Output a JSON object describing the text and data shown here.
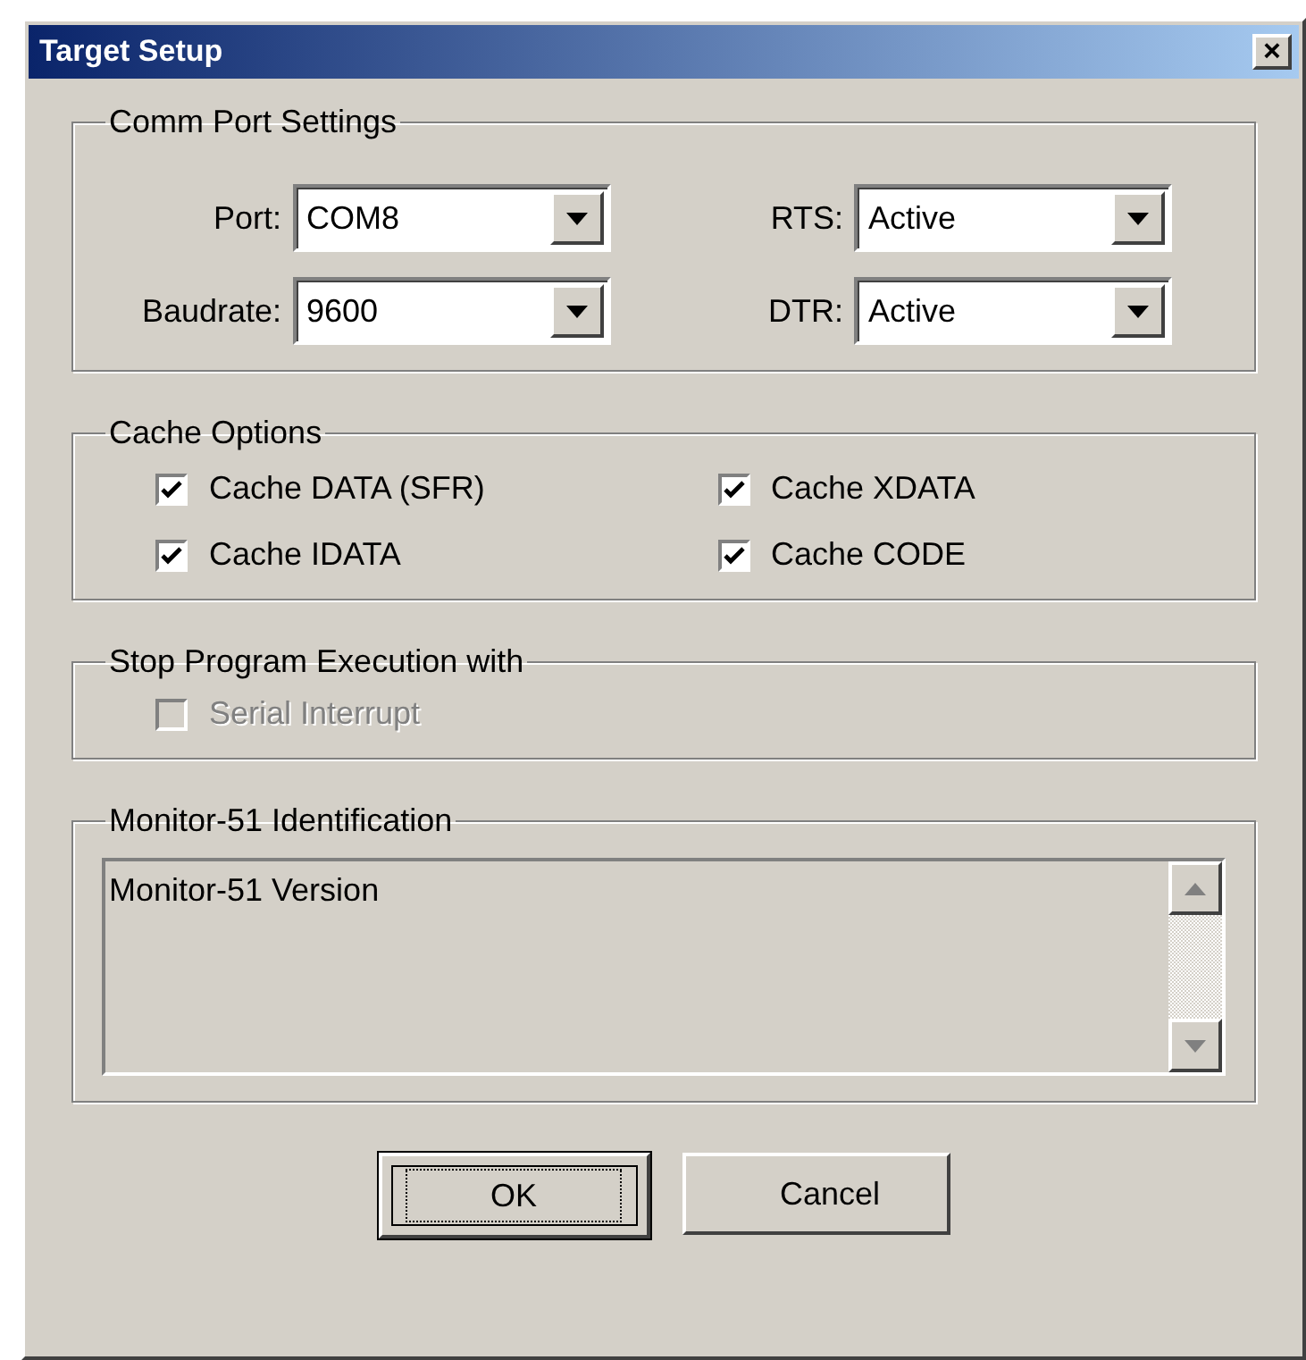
{
  "window": {
    "title": "Target Setup",
    "close": "×"
  },
  "comm_port_settings": {
    "title": "Comm Port Settings",
    "fields": [
      {
        "label": "Port:",
        "value": "COM8"
      },
      {
        "label": "RTS:",
        "value": "Active"
      },
      {
        "label": "Baudrate:",
        "value": "9600"
      },
      {
        "label": "DTR:",
        "value": "Active"
      }
    ]
  },
  "cache_options": {
    "title": "Cache Options",
    "options": [
      {
        "label": "Cache DATA (SFR)",
        "checked": true,
        "disabled": false
      },
      {
        "label": "Cache XDATA",
        "checked": true,
        "disabled": false
      },
      {
        "label": "Cache IDATA",
        "checked": true,
        "disabled": false
      },
      {
        "label": "Cache CODE",
        "checked": true,
        "disabled": false
      }
    ]
  },
  "stop_program_execution": {
    "title": "Stop Program Execution with",
    "options": [
      {
        "label": "Serial Interrupt",
        "checked": false,
        "disabled": true
      }
    ]
  },
  "identification": {
    "title": "Monitor-51 Identification",
    "text": "Monitor-51 Version"
  },
  "buttons": [
    {
      "label": "OK",
      "focused": true
    },
    {
      "label": "Cancel",
      "focused": false
    }
  ]
}
